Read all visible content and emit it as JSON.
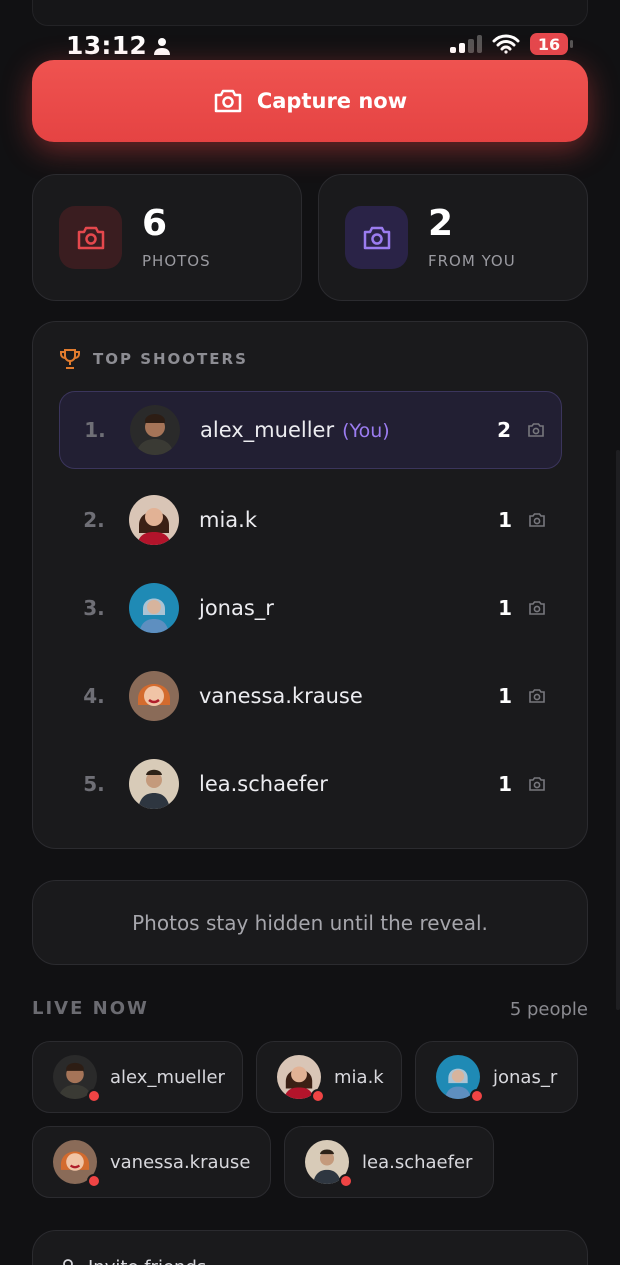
{
  "status": {
    "time": "13:12",
    "battery": "16"
  },
  "capture": {
    "label": "Capture now"
  },
  "stats": [
    {
      "value": "6",
      "label": "PHOTOS",
      "color": "#e5484d"
    },
    {
      "value": "2",
      "label": "FROM YOU",
      "color": "#9b7cf0"
    }
  ],
  "shooters": {
    "title": "TOP SHOOTERS",
    "rows": [
      {
        "rank": "1.",
        "name": "alex_mueller",
        "you": "(You)",
        "count": "2"
      },
      {
        "rank": "2.",
        "name": "mia.k",
        "count": "1"
      },
      {
        "rank": "3.",
        "name": "jonas_r",
        "count": "1"
      },
      {
        "rank": "4.",
        "name": "vanessa.krause",
        "count": "1"
      },
      {
        "rank": "5.",
        "name": "lea.schaefer",
        "count": "1"
      }
    ]
  },
  "note": "Photos stay hidden until the reveal.",
  "live": {
    "title": "LIVE NOW",
    "count": "5 people",
    "people": [
      "alex_mueller",
      "mia.k",
      "jonas_r",
      "vanessa.krause",
      "lea.schaefer"
    ]
  },
  "invite": {
    "label": "Invite friends"
  },
  "colors": {
    "accent": "#e5484d",
    "you": "#9b7cf0",
    "live_dot": "#ef4444"
  }
}
